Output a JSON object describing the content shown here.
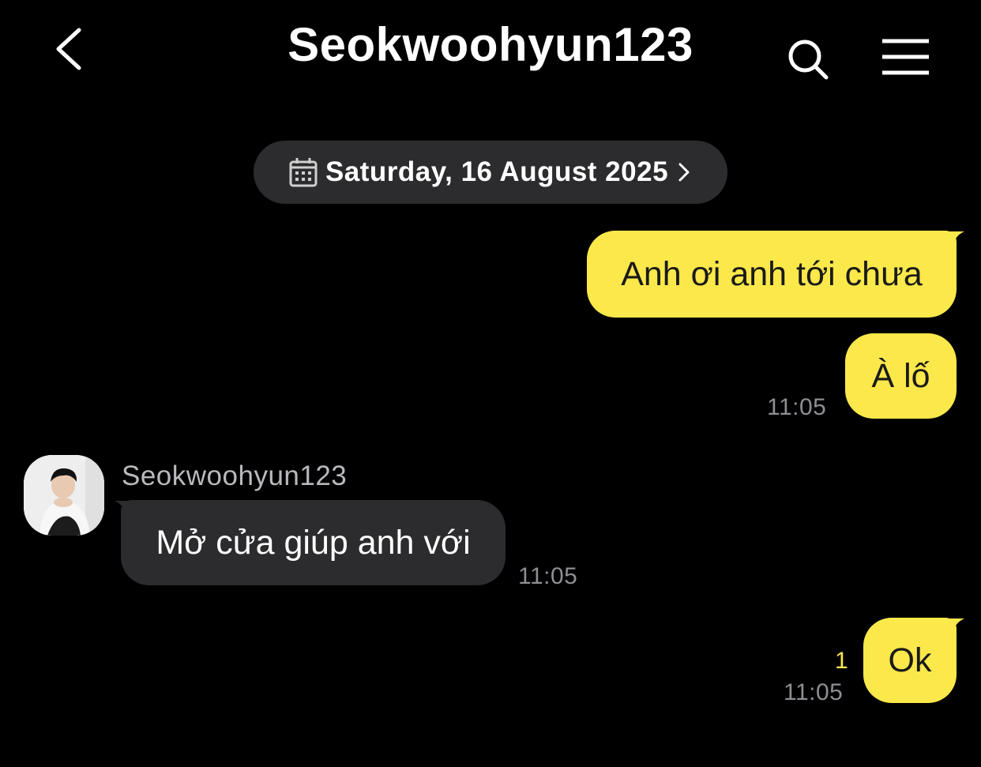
{
  "header": {
    "title": "Seokwoohyun123",
    "back_icon": "chevron-left-icon",
    "search_icon": "search-icon",
    "menu_icon": "hamburger-menu-icon"
  },
  "date_divider": {
    "label": "Saturday, 16 August 2025",
    "icon": "calendar-icon",
    "chevron": "chevron-right-icon"
  },
  "messages": [
    {
      "direction": "outgoing",
      "text": "Anh ơi anh tới chưa"
    },
    {
      "direction": "outgoing",
      "text": "À lố",
      "time": "11:05"
    },
    {
      "direction": "incoming",
      "sender": "Seokwoohyun123",
      "text": "Mở cửa giúp anh với",
      "time": "11:05"
    },
    {
      "direction": "outgoing",
      "text": "Ok",
      "time": "11:05",
      "unread_count": "1"
    }
  ],
  "colors": {
    "background": "#000000",
    "outgoing_bubble": "#fbe84a",
    "incoming_bubble": "#2c2c2e",
    "timestamp": "#8e8e93",
    "unread": "#fbe84a"
  }
}
